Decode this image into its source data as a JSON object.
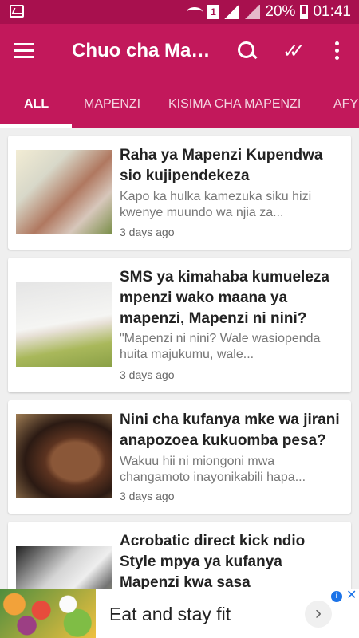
{
  "status_bar": {
    "battery": "20%",
    "time": "01:41",
    "sim_number": "1"
  },
  "app_bar": {
    "title": "Chuo cha Mapenzi",
    "menu_icon": "hamburger-menu-icon",
    "search_icon": "search-icon",
    "mark_read_icon": "double-check-icon",
    "overflow_icon": "vertical-dots-icon"
  },
  "tabs": [
    {
      "label": "ALL",
      "selected": true
    },
    {
      "label": "MAPENZI",
      "selected": false
    },
    {
      "label": "KISIMA CHA MAPENZI",
      "selected": false
    },
    {
      "label": "AFY",
      "selected": false
    }
  ],
  "articles": [
    {
      "title": "Raha ya Mapenzi Kupendwa sio kujipendekeza",
      "excerpt": "Kapo ka hulka kamezuka siku hizi kwenye muundo wa njia za...",
      "time": "3 days ago"
    },
    {
      "title": "SMS ya kimahaba kumueleza mpenzi wako maana ya mapenzi, Mapenzi ni nini?",
      "excerpt": "\"Mapenzi ni nini? Wale wasiopenda huita majukumu, wale...",
      "time": "3 days ago"
    },
    {
      "title": "Nini cha kufanya mke wa jirani anapozoea kukuomba pesa?",
      "excerpt": "Wakuu hii ni miongoni mwa changamoto inayonikabili hapa...",
      "time": "3 days ago"
    },
    {
      "title": "Acrobatic direct kick ndio Style mpya ya kufanya Mapenzi kwa sasa",
      "excerpt": "",
      "time": ""
    }
  ],
  "ad": {
    "text": "Eat and stay fit",
    "info_icon": "info-icon",
    "close_icon": "close-icon",
    "arrow_icon": "chevron-right-icon"
  },
  "colors": {
    "status_bar": "#a8104e",
    "app_bar": "#c2185b",
    "background": "#efefef",
    "ad_accent": "#1b73e8"
  }
}
